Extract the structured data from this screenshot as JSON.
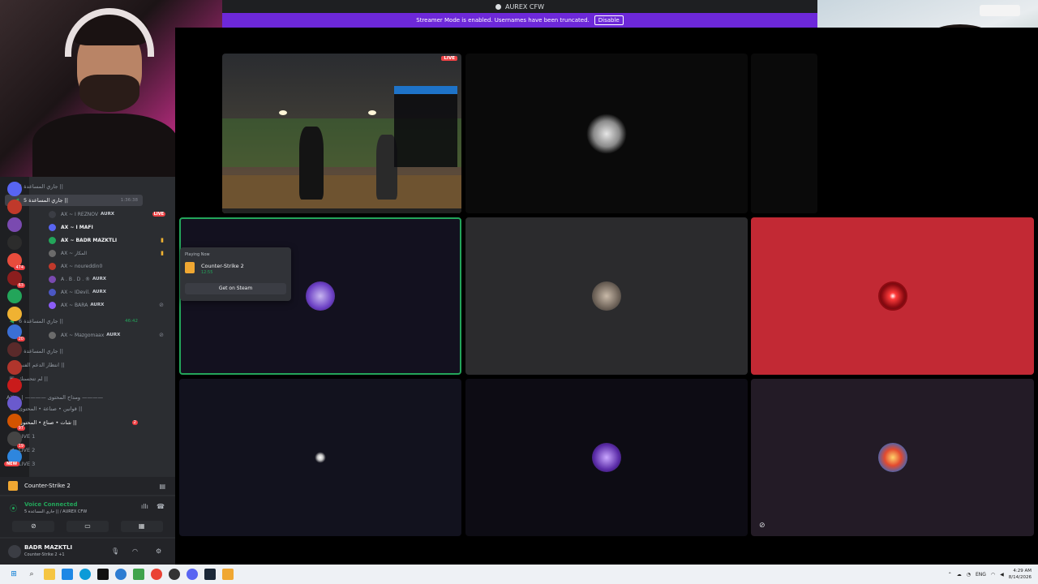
{
  "window": {
    "title": "AUREX CFW"
  },
  "banner": {
    "text": "Streamer Mode is enabled. Usernames have been truncated.",
    "button": "Disable"
  },
  "servers": [
    {
      "color": "#5865f2",
      "badge": ""
    },
    {
      "color": "#c0392b",
      "badge": ""
    },
    {
      "color": "#7a4ab0",
      "badge": ""
    },
    {
      "color": "#2c2c2c",
      "badge": ""
    },
    {
      "color": "#e74c3c",
      "badge": "474"
    },
    {
      "color": "#8b1e1e",
      "badge": "63"
    },
    {
      "color": "#23a55a",
      "badge": ""
    },
    {
      "color": "#f0b232",
      "badge": ""
    },
    {
      "color": "#3b6fd4",
      "badge": "20"
    },
    {
      "color": "#5a2a2a",
      "badge": ""
    },
    {
      "color": "#b0352c",
      "badge": ""
    },
    {
      "color": "#c91b1b",
      "badge": ""
    },
    {
      "color": "#6a5acd",
      "badge": ""
    },
    {
      "color": "#d35400",
      "badge": "97"
    },
    {
      "color": "#444",
      "badge": "19"
    },
    {
      "color": "#2e86de",
      "badge": ""
    }
  ],
  "server_new_label": "NEW",
  "channels": {
    "voice4": {
      "label": "جاري المساعدة 4 ||"
    },
    "voice5": {
      "label": "جاري المساعدة 5 ||",
      "time": "1:36:38"
    },
    "members5": [
      {
        "name": "AX ~ I REZNOV",
        "badge": "AURX",
        "live": "LIVE"
      },
      {
        "name": "AX ~ I MAFI",
        "badge": "",
        "live": ""
      },
      {
        "name": "AX ~ BADR MAZKTLI",
        "badge": "",
        "live": ""
      },
      {
        "name": "AX ~ المكار",
        "badge": "",
        "live": ""
      },
      {
        "name": "AX ~ noureddin0",
        "badge": "",
        "live": ""
      },
      {
        "name": "A . B . D . ®",
        "badge": "AURX",
        "live": ""
      },
      {
        "name": "AX ~ IDevil.",
        "badge": "AURX",
        "live": ""
      },
      {
        "name": "AX ~ BARA",
        "badge": "AURX",
        "live": ""
      }
    ],
    "voice6": {
      "label": "جاري المساعدة 6 ||",
      "time": "46:42"
    },
    "members6": [
      {
        "name": "AX ~ Mazgomaax",
        "badge": "AURX"
      }
    ],
    "voice7": {
      "label": "جاري المساعدة 7 ||"
    },
    "voice8": {
      "label": "انتظار الدعم الفني ||"
    },
    "voice9": {
      "label": "لم تتحسنك ||"
    },
    "category": {
      "label": "AX ~ | ———— ومداح المحتوى ————"
    },
    "text1": {
      "label": "قوانين • صناعة • المحتوى ||"
    },
    "text2": {
      "label": "شات • صناع • المحتوى ||",
      "badge": "2"
    },
    "live1": {
      "label": "LIVE 1"
    },
    "live2": {
      "label": "LIVE 2"
    },
    "live3": {
      "label": "LIVE 3"
    }
  },
  "activity": {
    "game": "Counter-Strike 2"
  },
  "voice": {
    "status": "Voice Connected",
    "detail": "جاري المساعدة 5 || / AUREX CFW"
  },
  "user": {
    "name": "BADR MAZKTLI",
    "status": "Counter-Strike 2 +1"
  },
  "stream_tile": {
    "live": "LIVE"
  },
  "popup": {
    "header": "Playing Now",
    "game": "Counter-Strike 2",
    "time": "12:55",
    "button": "Get on Steam"
  },
  "taskbar": {
    "lang": "ENG",
    "time": "4:29 AM",
    "date": "8/14/2026"
  },
  "colors": {
    "accent": "#6d28d9",
    "voice_green": "#23a55a",
    "live_red": "#ed4245",
    "red_tile": "#c22934"
  }
}
